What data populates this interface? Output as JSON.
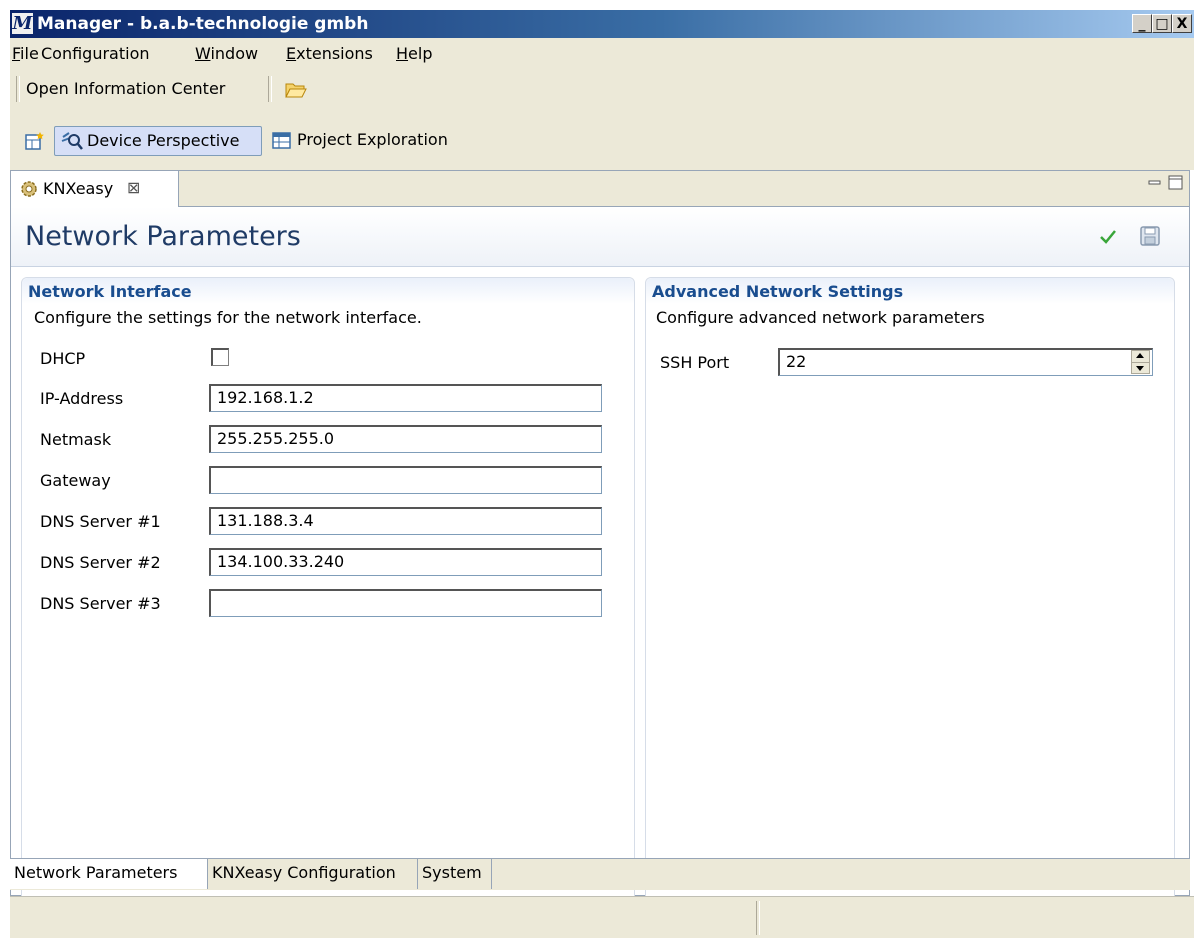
{
  "window": {
    "title": "Manager - b.a.b-technologie gmbh",
    "logo_letter": "M",
    "minimize_glyph": "_",
    "maximize_glyph": "□",
    "close_glyph": "X"
  },
  "menubar": {
    "items": [
      {
        "mnemonic": "F",
        "rest": "ile"
      },
      {
        "mnemonic": "",
        "rest": "Configuration"
      },
      {
        "mnemonic": "W",
        "rest": "indow"
      },
      {
        "mnemonic": "E",
        "rest": "xtensions"
      },
      {
        "mnemonic": "H",
        "rest": "elp"
      }
    ]
  },
  "toolbar": {
    "open_info_label": "Open Information Center",
    "open_folder_icon": "folder-open-icon"
  },
  "perspectives": {
    "items": [
      {
        "label": "Device Perspective",
        "icon": "device-search-icon",
        "active": true
      },
      {
        "label": "Project Exploration",
        "icon": "table-icon",
        "active": false
      }
    ]
  },
  "editor": {
    "tab_label": "KNXeasy",
    "tab_close_glyph": "⊠",
    "page_title": "Network Parameters"
  },
  "network_interface": {
    "title": "Network Interface",
    "description": "Configure the settings for the network interface.",
    "dhcp_label": "DHCP",
    "dhcp_checked": false,
    "fields": [
      {
        "label": "IP-Address",
        "value": "192.168.1.2"
      },
      {
        "label": "Netmask",
        "value": "255.255.255.0"
      },
      {
        "label": "Gateway",
        "value": ""
      },
      {
        "label": "DNS Server #1",
        "value": "131.188.3.4"
      },
      {
        "label": "DNS Server #2",
        "value": "134.100.33.240"
      },
      {
        "label": "DNS Server #3",
        "value": ""
      }
    ]
  },
  "advanced": {
    "title": "Advanced Network Settings",
    "description": "Configure advanced network parameters",
    "ssh_label": "SSH Port",
    "ssh_value": "22"
  },
  "page_tabs": [
    {
      "label": "Network Parameters",
      "active": true
    },
    {
      "label": "KNXeasy Configuration",
      "active": false
    },
    {
      "label": "System",
      "active": false
    }
  ],
  "colors": {
    "title_bar": "#0a246a",
    "section_title": "#1a4d8f",
    "page_title": "#1f3b66",
    "chrome": "#ece9d8"
  }
}
